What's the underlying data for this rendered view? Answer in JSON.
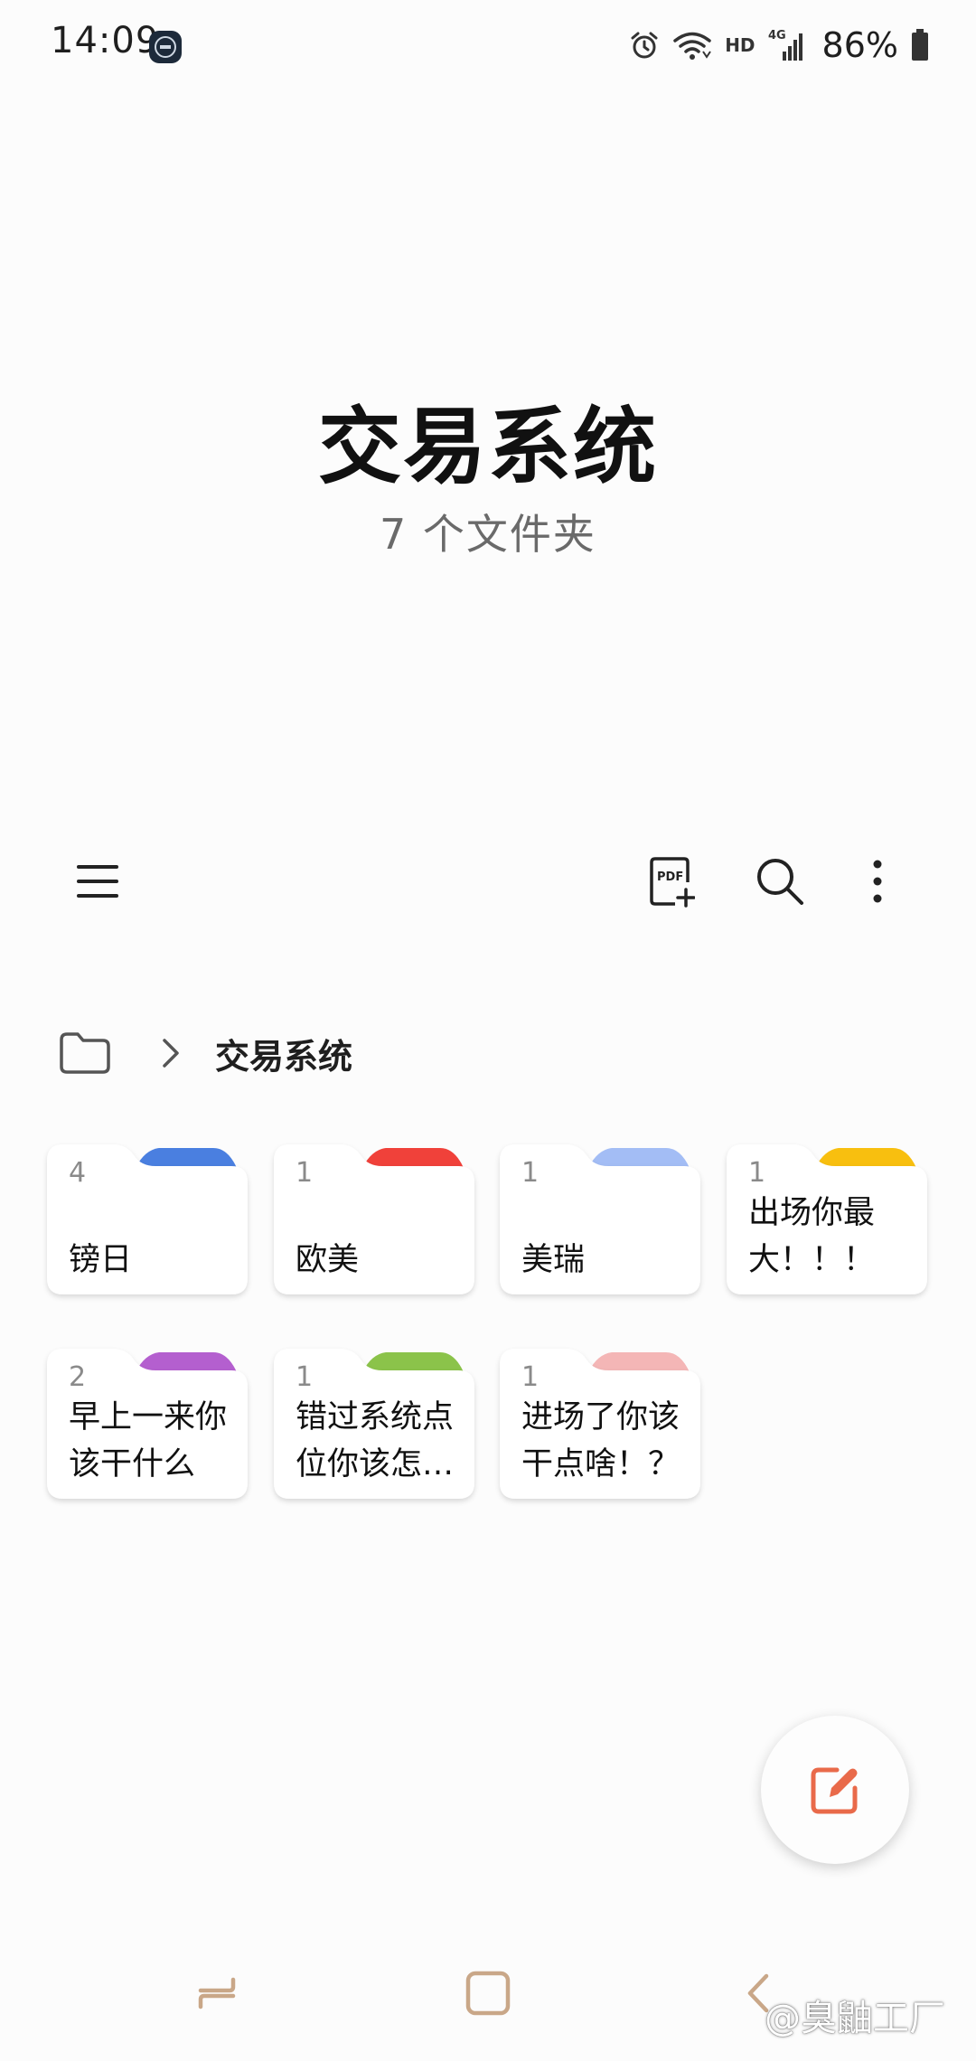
{
  "status_bar": {
    "time": "14:09",
    "network_label": "HD",
    "signal_label": "4G",
    "battery": "86%"
  },
  "header": {
    "title": "交易系统",
    "subtitle": "7 个文件夹"
  },
  "toolbar": {
    "menu_icon": "hamburger-menu-icon",
    "pdf_icon": "pdf-add-icon",
    "pdf_label": "PDF",
    "search_icon": "search-icon",
    "more_icon": "more-vertical-icon"
  },
  "breadcrumb": {
    "root_icon": "folder-icon",
    "separator_icon": "chevron-right-icon",
    "current": "交易系统"
  },
  "folders": [
    {
      "count": "4",
      "name": "镑日",
      "color": "#4a7fe0"
    },
    {
      "count": "1",
      "name": "欧美",
      "color": "#f0413a"
    },
    {
      "count": "1",
      "name": "美瑞",
      "color": "#a3bdf5"
    },
    {
      "count": "1",
      "name": "出场你最大！！！",
      "color": "#f8bf0f"
    },
    {
      "count": "2",
      "name": "早上一来你该干什么",
      "color": "#b45fcf"
    },
    {
      "count": "1",
      "name": "错过系统点位你该怎么办",
      "color": "#8bc34a"
    },
    {
      "count": "1",
      "name": "进场了你该干点啥！？",
      "color": "#f4b6b6"
    }
  ],
  "fab": {
    "icon": "compose-note-icon",
    "color": "#e96a4a"
  },
  "watermark": "@臭鼬工厂"
}
